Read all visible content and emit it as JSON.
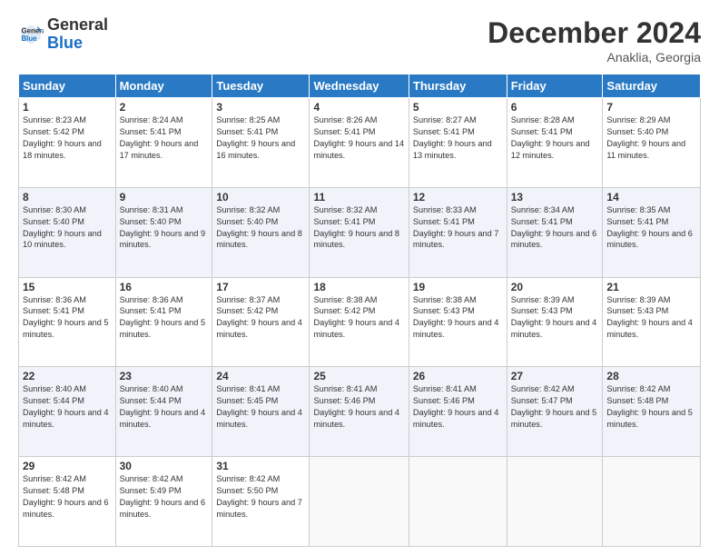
{
  "logo": {
    "text_general": "General",
    "text_blue": "Blue"
  },
  "header": {
    "month": "December 2024",
    "location": "Anaklia, Georgia"
  },
  "weekdays": [
    "Sunday",
    "Monday",
    "Tuesday",
    "Wednesday",
    "Thursday",
    "Friday",
    "Saturday"
  ],
  "weeks": [
    [
      {
        "day": "1",
        "sunrise": "8:23 AM",
        "sunset": "5:42 PM",
        "daylight": "9 hours and 18 minutes."
      },
      {
        "day": "2",
        "sunrise": "8:24 AM",
        "sunset": "5:41 PM",
        "daylight": "9 hours and 17 minutes."
      },
      {
        "day": "3",
        "sunrise": "8:25 AM",
        "sunset": "5:41 PM",
        "daylight": "9 hours and 16 minutes."
      },
      {
        "day": "4",
        "sunrise": "8:26 AM",
        "sunset": "5:41 PM",
        "daylight": "9 hours and 14 minutes."
      },
      {
        "day": "5",
        "sunrise": "8:27 AM",
        "sunset": "5:41 PM",
        "daylight": "9 hours and 13 minutes."
      },
      {
        "day": "6",
        "sunrise": "8:28 AM",
        "sunset": "5:41 PM",
        "daylight": "9 hours and 12 minutes."
      },
      {
        "day": "7",
        "sunrise": "8:29 AM",
        "sunset": "5:40 PM",
        "daylight": "9 hours and 11 minutes."
      }
    ],
    [
      {
        "day": "8",
        "sunrise": "8:30 AM",
        "sunset": "5:40 PM",
        "daylight": "9 hours and 10 minutes."
      },
      {
        "day": "9",
        "sunrise": "8:31 AM",
        "sunset": "5:40 PM",
        "daylight": "9 hours and 9 minutes."
      },
      {
        "day": "10",
        "sunrise": "8:32 AM",
        "sunset": "5:40 PM",
        "daylight": "9 hours and 8 minutes."
      },
      {
        "day": "11",
        "sunrise": "8:32 AM",
        "sunset": "5:41 PM",
        "daylight": "9 hours and 8 minutes."
      },
      {
        "day": "12",
        "sunrise": "8:33 AM",
        "sunset": "5:41 PM",
        "daylight": "9 hours and 7 minutes."
      },
      {
        "day": "13",
        "sunrise": "8:34 AM",
        "sunset": "5:41 PM",
        "daylight": "9 hours and 6 minutes."
      },
      {
        "day": "14",
        "sunrise": "8:35 AM",
        "sunset": "5:41 PM",
        "daylight": "9 hours and 6 minutes."
      }
    ],
    [
      {
        "day": "15",
        "sunrise": "8:36 AM",
        "sunset": "5:41 PM",
        "daylight": "9 hours and 5 minutes."
      },
      {
        "day": "16",
        "sunrise": "8:36 AM",
        "sunset": "5:41 PM",
        "daylight": "9 hours and 5 minutes."
      },
      {
        "day": "17",
        "sunrise": "8:37 AM",
        "sunset": "5:42 PM",
        "daylight": "9 hours and 4 minutes."
      },
      {
        "day": "18",
        "sunrise": "8:38 AM",
        "sunset": "5:42 PM",
        "daylight": "9 hours and 4 minutes."
      },
      {
        "day": "19",
        "sunrise": "8:38 AM",
        "sunset": "5:43 PM",
        "daylight": "9 hours and 4 minutes."
      },
      {
        "day": "20",
        "sunrise": "8:39 AM",
        "sunset": "5:43 PM",
        "daylight": "9 hours and 4 minutes."
      },
      {
        "day": "21",
        "sunrise": "8:39 AM",
        "sunset": "5:43 PM",
        "daylight": "9 hours and 4 minutes."
      }
    ],
    [
      {
        "day": "22",
        "sunrise": "8:40 AM",
        "sunset": "5:44 PM",
        "daylight": "9 hours and 4 minutes."
      },
      {
        "day": "23",
        "sunrise": "8:40 AM",
        "sunset": "5:44 PM",
        "daylight": "9 hours and 4 minutes."
      },
      {
        "day": "24",
        "sunrise": "8:41 AM",
        "sunset": "5:45 PM",
        "daylight": "9 hours and 4 minutes."
      },
      {
        "day": "25",
        "sunrise": "8:41 AM",
        "sunset": "5:46 PM",
        "daylight": "9 hours and 4 minutes."
      },
      {
        "day": "26",
        "sunrise": "8:41 AM",
        "sunset": "5:46 PM",
        "daylight": "9 hours and 4 minutes."
      },
      {
        "day": "27",
        "sunrise": "8:42 AM",
        "sunset": "5:47 PM",
        "daylight": "9 hours and 5 minutes."
      },
      {
        "day": "28",
        "sunrise": "8:42 AM",
        "sunset": "5:48 PM",
        "daylight": "9 hours and 5 minutes."
      }
    ],
    [
      {
        "day": "29",
        "sunrise": "8:42 AM",
        "sunset": "5:48 PM",
        "daylight": "9 hours and 6 minutes."
      },
      {
        "day": "30",
        "sunrise": "8:42 AM",
        "sunset": "5:49 PM",
        "daylight": "9 hours and 6 minutes."
      },
      {
        "day": "31",
        "sunrise": "8:42 AM",
        "sunset": "5:50 PM",
        "daylight": "9 hours and 7 minutes."
      },
      null,
      null,
      null,
      null
    ]
  ],
  "labels": {
    "sunrise": "Sunrise:",
    "sunset": "Sunset:",
    "daylight": "Daylight:"
  }
}
